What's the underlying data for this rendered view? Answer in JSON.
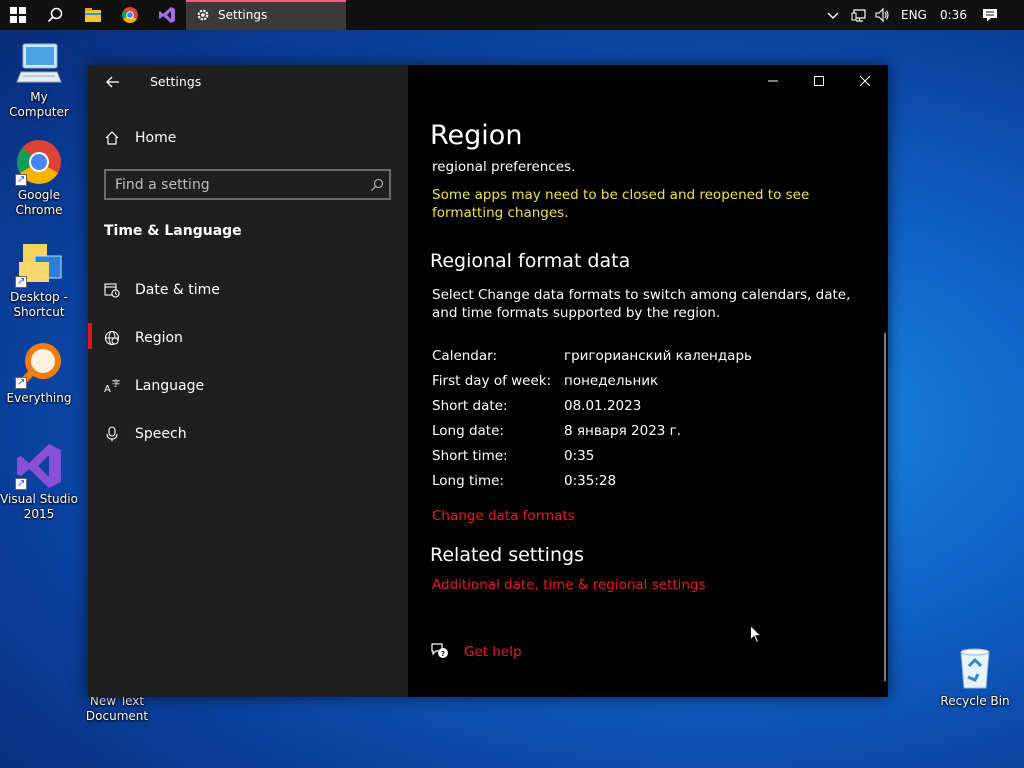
{
  "taskbar": {
    "active_app_label": "Settings",
    "language": "ENG",
    "clock": "0:36"
  },
  "desktop": {
    "icons": [
      {
        "label": "My Computer"
      },
      {
        "label": "Google Chrome"
      },
      {
        "label": "Desktop - Shortcut"
      },
      {
        "label": "Everything"
      },
      {
        "label": "Visual Studio 2015"
      },
      {
        "label": "New Text Document"
      },
      {
        "label": "Recycle Bin"
      }
    ]
  },
  "window": {
    "title": "Settings",
    "nav": {
      "home": "Home",
      "search_placeholder": "Find a setting",
      "section": "Time & Language",
      "items": [
        {
          "label": "Date & time",
          "icon": "calendar-clock-icon"
        },
        {
          "label": "Region",
          "icon": "globe-icon",
          "selected": true
        },
        {
          "label": "Language",
          "icon": "language-icon"
        },
        {
          "label": "Speech",
          "icon": "microphone-icon"
        }
      ]
    },
    "content": {
      "page_title": "Region",
      "intro_tail": "regional preferences.",
      "warning": "Some apps may need to be closed and reopened to see formatting changes.",
      "format_heading": "Regional format data",
      "format_desc": "Select Change data formats to switch among calendars, date, and time formats supported by the region.",
      "rows": [
        {
          "label": "Calendar:",
          "value": "григорианский календарь"
        },
        {
          "label": "First day of week:",
          "value": "понедельник"
        },
        {
          "label": "Short date:",
          "value": "08.01.2023"
        },
        {
          "label": "Long date:",
          "value": "8 января 2023 г."
        },
        {
          "label": "Short time:",
          "value": "0:35"
        },
        {
          "label": "Long time:",
          "value": "0:35:28"
        }
      ],
      "change_link": "Change data formats",
      "related_heading": "Related settings",
      "related_link": "Additional date, time & regional settings",
      "help_link": "Get help"
    }
  },
  "colors": {
    "accent_red": "#e8172a",
    "warning_yellow": "#f1e04a",
    "selected_marker": "#e81123"
  }
}
